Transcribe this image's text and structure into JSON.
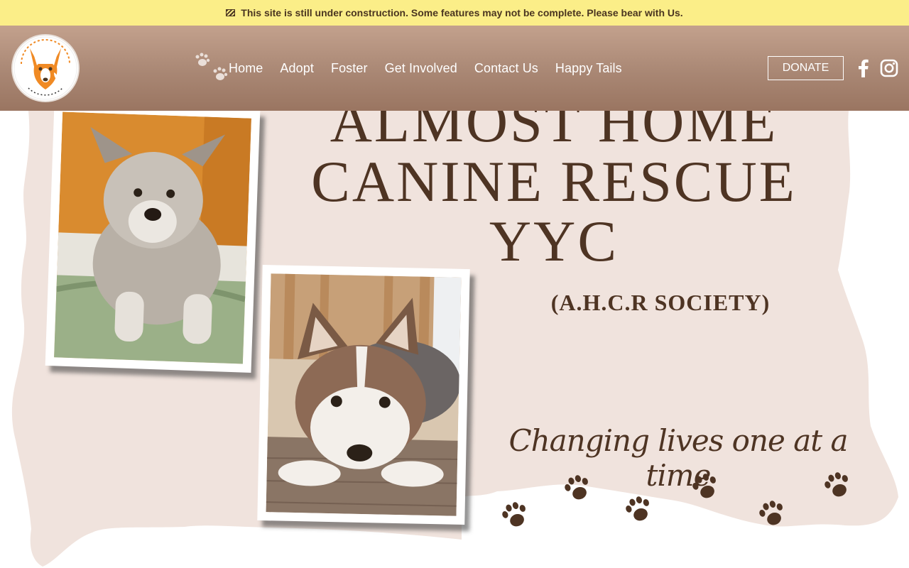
{
  "banner": {
    "icon": "construction-stripes-icon",
    "text": "This site is still under construction. Some features may not be complete. Please bear with Us."
  },
  "header": {
    "logo": {
      "icon": "dog-logo-icon",
      "ring_text_top": "ALMOST HOME CANINE RESCUE",
      "ring_text_bottom": "ADOPT A FURRVER FRIEND TODAY"
    },
    "nav": [
      {
        "label": "Home"
      },
      {
        "label": "Adopt"
      },
      {
        "label": "Foster"
      },
      {
        "label": "Get Involved"
      },
      {
        "label": "Contact Us"
      },
      {
        "label": "Happy Tails"
      }
    ],
    "donate_label": "DONATE",
    "social": [
      {
        "name": "facebook-icon"
      },
      {
        "name": "instagram-icon"
      }
    ]
  },
  "hero": {
    "title_line1": "ALMOST HOME",
    "title_line2": "CANINE RESCUE",
    "title_line3": "YYC",
    "subtitle": "(A.H.C.R SOCIETY)",
    "tagline": "Changing lives one at a time",
    "photos": [
      {
        "icon": "puppy-photo"
      },
      {
        "icon": "husky-puppy-photo"
      }
    ]
  },
  "colors": {
    "banner": "#fbee88",
    "header_top": "#c3a18d",
    "header_bottom": "#9a7561",
    "hero_paper": "#f0e3dd",
    "text_brown": "#4e3423"
  }
}
